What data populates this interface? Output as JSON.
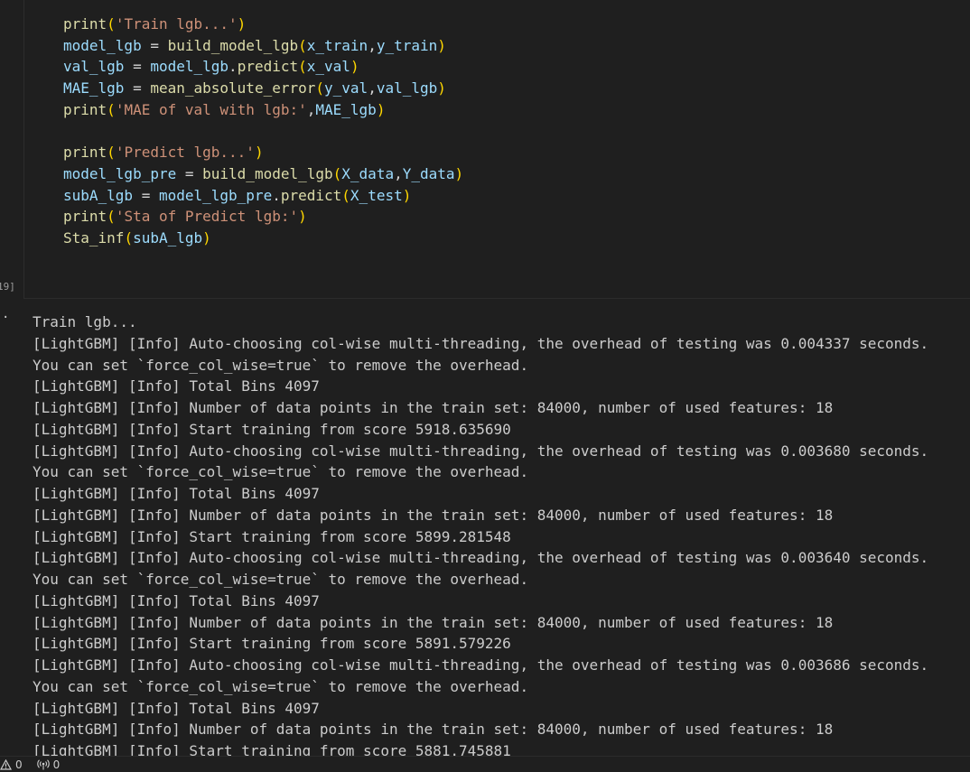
{
  "cell": {
    "execution_count": "19]",
    "code_lines": [
      [
        {
          "t": "fn",
          "v": "print"
        },
        {
          "t": "pn",
          "v": "("
        },
        {
          "t": "str",
          "v": "'Train lgb...'"
        },
        {
          "t": "pn",
          "v": ")"
        }
      ],
      [
        {
          "t": "var",
          "v": "model_lgb"
        },
        {
          "t": "op",
          "v": " = "
        },
        {
          "t": "fn",
          "v": "build_model_lgb"
        },
        {
          "t": "pn",
          "v": "("
        },
        {
          "t": "var",
          "v": "x_train"
        },
        {
          "t": "op",
          "v": ","
        },
        {
          "t": "var",
          "v": "y_train"
        },
        {
          "t": "pn",
          "v": ")"
        }
      ],
      [
        {
          "t": "var",
          "v": "val_lgb"
        },
        {
          "t": "op",
          "v": " = "
        },
        {
          "t": "var",
          "v": "model_lgb"
        },
        {
          "t": "op",
          "v": "."
        },
        {
          "t": "fn",
          "v": "predict"
        },
        {
          "t": "pn",
          "v": "("
        },
        {
          "t": "var",
          "v": "x_val"
        },
        {
          "t": "pn",
          "v": ")"
        }
      ],
      [
        {
          "t": "var",
          "v": "MAE_lgb"
        },
        {
          "t": "op",
          "v": " = "
        },
        {
          "t": "fn",
          "v": "mean_absolute_error"
        },
        {
          "t": "pn",
          "v": "("
        },
        {
          "t": "var",
          "v": "y_val"
        },
        {
          "t": "op",
          "v": ","
        },
        {
          "t": "var",
          "v": "val_lgb"
        },
        {
          "t": "pn",
          "v": ")"
        }
      ],
      [
        {
          "t": "fn",
          "v": "print"
        },
        {
          "t": "pn",
          "v": "("
        },
        {
          "t": "str",
          "v": "'MAE of val with lgb:'"
        },
        {
          "t": "op",
          "v": ","
        },
        {
          "t": "var",
          "v": "MAE_lgb"
        },
        {
          "t": "pn",
          "v": ")"
        }
      ],
      [],
      [
        {
          "t": "fn",
          "v": "print"
        },
        {
          "t": "pn",
          "v": "("
        },
        {
          "t": "str",
          "v": "'Predict lgb...'"
        },
        {
          "t": "pn",
          "v": ")"
        }
      ],
      [
        {
          "t": "var",
          "v": "model_lgb_pre"
        },
        {
          "t": "op",
          "v": " = "
        },
        {
          "t": "fn",
          "v": "build_model_lgb"
        },
        {
          "t": "pn",
          "v": "("
        },
        {
          "t": "var",
          "v": "X_data"
        },
        {
          "t": "op",
          "v": ","
        },
        {
          "t": "var",
          "v": "Y_data"
        },
        {
          "t": "pn",
          "v": ")"
        }
      ],
      [
        {
          "t": "var",
          "v": "subA_lgb"
        },
        {
          "t": "op",
          "v": " = "
        },
        {
          "t": "var",
          "v": "model_lgb_pre"
        },
        {
          "t": "op",
          "v": "."
        },
        {
          "t": "fn",
          "v": "predict"
        },
        {
          "t": "pn",
          "v": "("
        },
        {
          "t": "var",
          "v": "X_test"
        },
        {
          "t": "pn",
          "v": ")"
        }
      ],
      [
        {
          "t": "fn",
          "v": "print"
        },
        {
          "t": "pn",
          "v": "("
        },
        {
          "t": "str",
          "v": "'Sta of Predict lgb:'"
        },
        {
          "t": "pn",
          "v": ")"
        }
      ],
      [
        {
          "t": "fn",
          "v": "Sta_inf"
        },
        {
          "t": "pn",
          "v": "("
        },
        {
          "t": "var",
          "v": "subA_lgb"
        },
        {
          "t": "pn",
          "v": ")"
        }
      ]
    ]
  },
  "output": {
    "marker": "·",
    "lines": [
      "Train lgb...",
      "[LightGBM] [Info] Auto-choosing col-wise multi-threading, the overhead of testing was 0.004337 seconds.",
      "You can set `force_col_wise=true` to remove the overhead.",
      "[LightGBM] [Info] Total Bins 4097",
      "[LightGBM] [Info] Number of data points in the train set: 84000, number of used features: 18",
      "[LightGBM] [Info] Start training from score 5918.635690",
      "[LightGBM] [Info] Auto-choosing col-wise multi-threading, the overhead of testing was 0.003680 seconds.",
      "You can set `force_col_wise=true` to remove the overhead.",
      "[LightGBM] [Info] Total Bins 4097",
      "[LightGBM] [Info] Number of data points in the train set: 84000, number of used features: 18",
      "[LightGBM] [Info] Start training from score 5899.281548",
      "[LightGBM] [Info] Auto-choosing col-wise multi-threading, the overhead of testing was 0.003640 seconds.",
      "You can set `force_col_wise=true` to remove the overhead.",
      "[LightGBM] [Info] Total Bins 4097",
      "[LightGBM] [Info] Number of data points in the train set: 84000, number of used features: 18",
      "[LightGBM] [Info] Start training from score 5891.579226",
      "[LightGBM] [Info] Auto-choosing col-wise multi-threading, the overhead of testing was 0.003686 seconds.",
      "You can set `force_col_wise=true` to remove the overhead.",
      "[LightGBM] [Info] Total Bins 4097",
      "[LightGBM] [Info] Number of data points in the train set: 84000, number of used features: 18",
      "[LightGBM] [Info] Start training from score 5881.745881"
    ]
  },
  "statusbar": {
    "warnings_count": "0",
    "ports_count": "0"
  },
  "colors": {
    "background": "#1f1f1f",
    "function": "#dcdcaa",
    "variable": "#9cdcfe",
    "string": "#ce9178",
    "bracket": "#ffd700",
    "output_text": "#cccccc"
  }
}
